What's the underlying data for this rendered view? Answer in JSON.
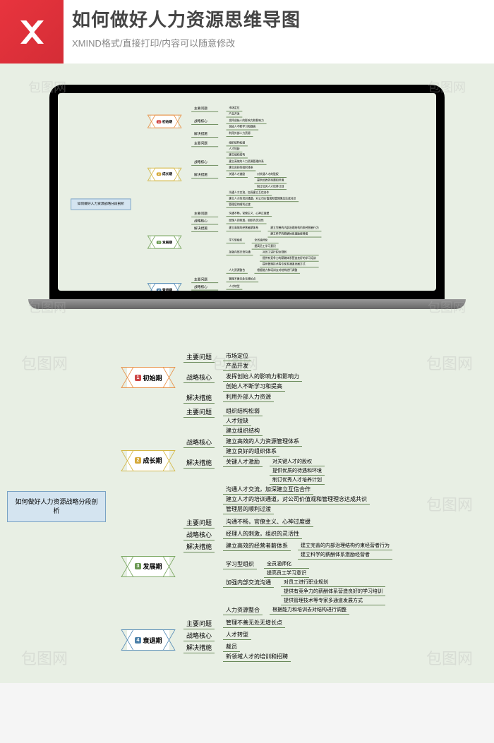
{
  "header": {
    "title": "如何做好人力资源思维导图",
    "subtitle": "XMIND格式/直接打印/内容可以随意修改"
  },
  "watermark": "包图网",
  "mindmap": {
    "root": "如何做好人力资源战略分段剖析",
    "phases": [
      {
        "num": "1",
        "label": "初始期",
        "color": "orange",
        "children": [
          {
            "label": "主要问题",
            "children": [
              {
                "label": "市场定位"
              },
              {
                "label": "产品开发"
              }
            ]
          },
          {
            "label": "战略核心",
            "children": [
              {
                "label": "发挥创始人的影响力和影响力"
              },
              {
                "label": "创始人不断学习和提高"
              }
            ]
          },
          {
            "label": "解决措施",
            "children": [
              {
                "label": "利用外部人力资源"
              }
            ]
          }
        ]
      },
      {
        "num": "2",
        "label": "成长期",
        "color": "yellow",
        "children": [
          {
            "label": "主要问题",
            "children": [
              {
                "label": "组织结构松弱"
              },
              {
                "label": "人才短缺"
              },
              {
                "label": "建立组织结构"
              }
            ]
          },
          {
            "label": "战略核心",
            "children": [
              {
                "label": "建立高效的人力资源管理体系"
              },
              {
                "label": "建立良好的组织体系"
              }
            ]
          },
          {
            "label": "解决措施",
            "children": [
              {
                "label": "关键人才激励",
                "children": [
                  {
                    "label": "对关键人才的股权"
                  },
                  {
                    "label": "提供优质的待遇和环境"
                  },
                  {
                    "label": "制订优秀人才培养计划"
                  }
                ]
              },
              {
                "label": "沟通人才交流，加深建立互信合作"
              },
              {
                "label": "建立人才的培训通道，对公司价值观和管理理念达成共识"
              },
              {
                "label": "管理层的顺利过渡"
              }
            ]
          }
        ]
      },
      {
        "num": "3",
        "label": "发展期",
        "color": "green",
        "children": [
          {
            "label": "主要问题",
            "children": [
              {
                "label": "沟通不畅，官僚主义、心神过度缓"
              }
            ]
          },
          {
            "label": "战略核心",
            "children": [
              {
                "label": "经理人的刺激，组织的灵活性"
              }
            ]
          },
          {
            "label": "解决措施",
            "children": [
              {
                "label": "建立高效的经营者薪体系",
                "children": [
                  {
                    "label": "建立完善的内部治理结构约束经营者行为"
                  },
                  {
                    "label": "建立科学的薪酬体系激励经营者"
                  }
                ]
              },
              {
                "label": "学习型组织",
                "children": [
                  {
                    "label": "全员涵师化"
                  },
                  {
                    "label": "提高员工学习意识"
                  }
                ]
              },
              {
                "label": "加强内部交流沟通",
                "children": [
                  {
                    "label": "对员工进行职业规划"
                  },
                  {
                    "label": "提供有竞争力的薪酬体系营造良好的学习培训"
                  },
                  {
                    "label": "提供管理技术等专家多通道发展方式"
                  }
                ]
              },
              {
                "label": "人力资源整合",
                "children": [
                  {
                    "label": "根据能力和培训去对结构进行调整"
                  }
                ]
              }
            ]
          }
        ]
      },
      {
        "num": "4",
        "label": "衰退期",
        "color": "blue",
        "children": [
          {
            "label": "主要问题",
            "children": [
              {
                "label": "管理不善无处无增长点"
              }
            ]
          },
          {
            "label": "战略核心",
            "children": [
              {
                "label": "人才转型"
              }
            ]
          },
          {
            "label": "解决措施",
            "children": [
              {
                "label": "裁员"
              },
              {
                "label": "新领域人才的培训和招聘"
              }
            ]
          }
        ]
      }
    ]
  }
}
